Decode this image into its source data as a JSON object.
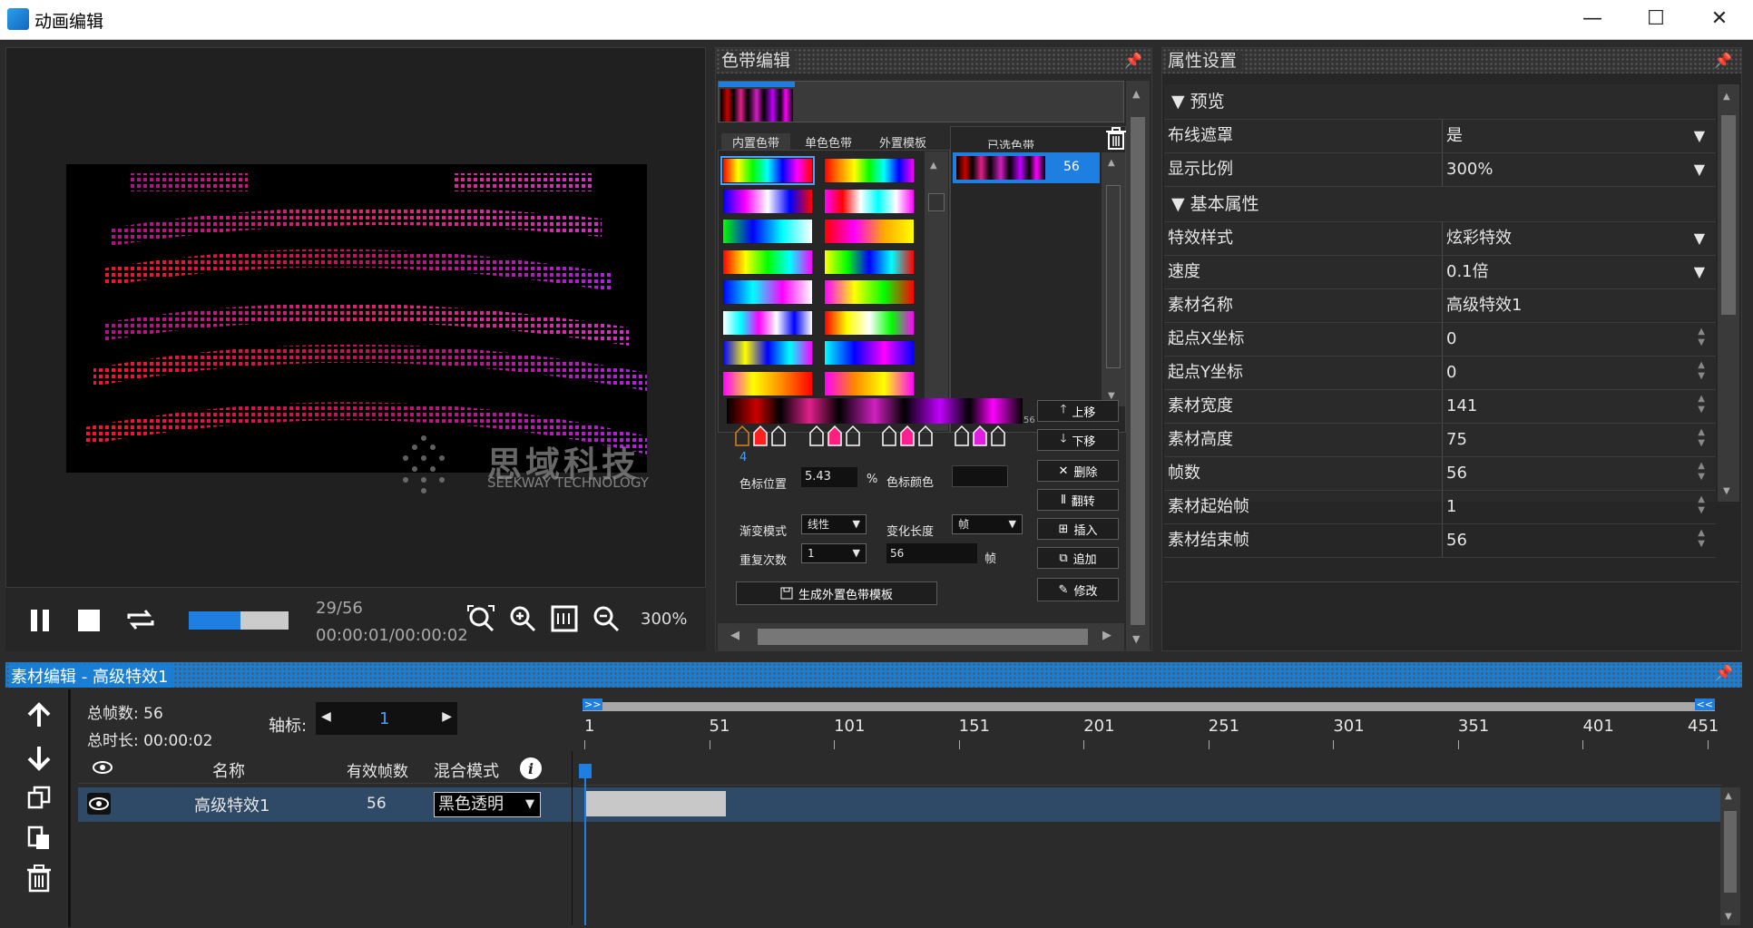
{
  "window": {
    "title": "动画编辑",
    "ctl_min": "—",
    "ctl_max": "☐",
    "ctl_close": "✕"
  },
  "preview": {
    "frame_counter": "29/56",
    "time": "00:00:01/00:00:02",
    "zoom": "300%",
    "progress": 0.52,
    "watermark_cn": "思域科技",
    "watermark_en": "SEEKWAY TECHNOLOGY"
  },
  "color_band": {
    "title": "色带编辑",
    "tabs": [
      "内置色带",
      "单色色带",
      "外置模板",
      "已选色带"
    ],
    "selected_count": "56",
    "selected_footer": "56",
    "marker_index": "4",
    "marker_pos_label": "色标位置",
    "marker_pos_value": "5.43",
    "percent": "%",
    "marker_color_label": "色标颜色",
    "grad_mode_label": "渐变模式",
    "grad_mode_value": "线性",
    "change_len_label": "变化长度",
    "change_len_value": "帧",
    "repeat_label": "重复次数",
    "repeat_value": "1",
    "frames_value": "56",
    "frames_unit": "帧",
    "generate_btn": "生成外置色带模板",
    "btn_up": "上移",
    "btn_down": "下移",
    "btn_delete": "删除",
    "btn_reverse": "翻转",
    "btn_insert": "插入",
    "btn_add": "追加",
    "btn_modify": "修改",
    "swatches": [
      "linear-gradient(90deg,#f00,#ff0,#0f0,#0ff,#00f,#f0f,#f00)",
      "linear-gradient(90deg,#f00,#f80,#ff0,#0f0,#0ff,#00f,#f0f)",
      "linear-gradient(90deg,#00f,#f0f,#fff,#00f,#f00)",
      "linear-gradient(90deg,#f0f,#f00,#fff,#0ff,#fff,#f0f)",
      "linear-gradient(90deg,#0f0,#00f,#0ff,#fff)",
      "linear-gradient(90deg,#f00,#f0f,#fa0,#ff0)",
      "linear-gradient(90deg,#f00,#ff0,#0f0,#0ff,#f0f)",
      "linear-gradient(90deg,#ff0,#0f0,#00f,#0ff,#f00)",
      "linear-gradient(90deg,#00f,#0ff,#f0f,#fff)",
      "linear-gradient(90deg,#f0f,#ff0,#0f0,#f00)",
      "linear-gradient(90deg,#fff,#0ff,#f0f,#fff,#00f,#fff)",
      "linear-gradient(90deg,#f00,#ff0,#fff,#0f0,#f0f)",
      "linear-gradient(90deg,#00f,#ff0,#00f,#0ff,#f0f)",
      "linear-gradient(90deg,#0ff,#00f,#f0f,#00f)",
      "linear-gradient(90deg,#f0f,#ff0,#f80,#f00)",
      "linear-gradient(90deg,#f0f,#f80,#ff0,#f0f)"
    ],
    "band_preview": "linear-gradient(90deg,#000 0%,#c00 10%,#000 18%,#e0208a 28%,#000 38%,#d020c0 50%,#000 60%,#c000ff 72%,#000 82%,#f0f 90%,#000 100%)"
  },
  "props": {
    "title": "属性设置",
    "group_preview": "▼ 预览",
    "group_basic": "▼ 基本属性",
    "preview_rows": [
      {
        "key": "布线遮罩",
        "value": "是",
        "kind": "drop"
      },
      {
        "key": "显示比例",
        "value": "300%",
        "kind": "drop"
      }
    ],
    "basic_rows": [
      {
        "key": "特效样式",
        "value": "炫彩特效",
        "kind": "drop"
      },
      {
        "key": "速度",
        "value": "0.1倍",
        "kind": "drop"
      },
      {
        "key": "素材名称",
        "value": "高级特效1",
        "kind": "text"
      },
      {
        "key": "起点X坐标",
        "value": "0",
        "kind": "spin"
      },
      {
        "key": "起点Y坐标",
        "value": "0",
        "kind": "spin"
      },
      {
        "key": "素材宽度",
        "value": "141",
        "kind": "spin"
      },
      {
        "key": "素材高度",
        "value": "75",
        "kind": "spin"
      },
      {
        "key": "帧数",
        "value": "56",
        "kind": "spin"
      },
      {
        "key": "素材起始帧",
        "value": "1",
        "kind": "spin"
      },
      {
        "key": "素材结束帧",
        "value": "56",
        "kind": "spin"
      }
    ],
    "drop_arrow": "▼",
    "spin_arrows": "▲\n▼"
  },
  "material": {
    "title": "素材编辑 - 高级特效1",
    "total_frames": "总帧数: 56",
    "total_duration": "总时长: 00:00:02",
    "axis_label": "轴标:",
    "axis_value": "1",
    "col_name": "名称",
    "col_frames": "有效帧数",
    "col_blend": "混合模式",
    "row_name": "高级特效1",
    "row_frames": "56",
    "row_blend": "黑色透明",
    "ticks": [
      "1",
      "51",
      "101",
      "151",
      "201",
      "251",
      "301",
      "351",
      "401",
      "451"
    ],
    "timeline_start": ">>",
    "timeline_end": "<<"
  }
}
